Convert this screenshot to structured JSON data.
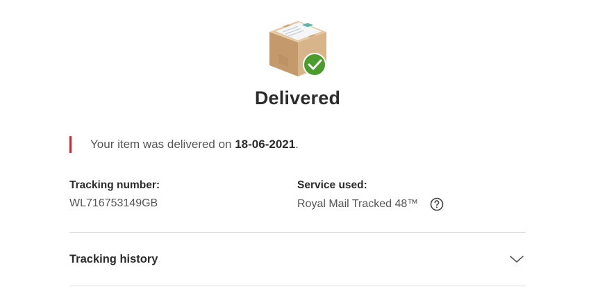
{
  "status": {
    "title": "Delivered",
    "accent_color": "#da202a",
    "success_color": "#4a9c2d",
    "icon": "delivered-parcel-icon"
  },
  "notice": {
    "text_before": "Your item was delivered on ",
    "date": "18-06-2021",
    "text_after": "."
  },
  "tracking": {
    "label": "Tracking number:",
    "value": "WL716753149GB"
  },
  "service": {
    "label": "Service used:",
    "value": "Royal Mail Tracked 48™",
    "help_icon": "question-circle-icon"
  },
  "history": {
    "label": "Tracking history",
    "expanded": false,
    "toggle_icon": "chevron-down-icon"
  }
}
